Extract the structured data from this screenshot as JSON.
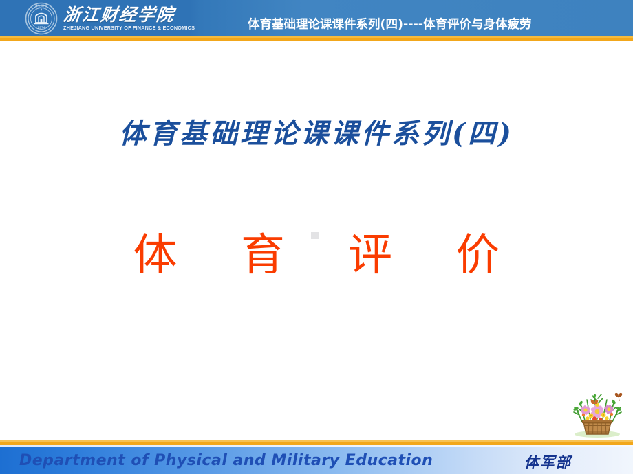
{
  "slide": {
    "header": {
      "logo": {
        "seal_icon": "university-seal-icon",
        "university_name_cn": "浙江财经学院",
        "university_name_en": "ZHEJIANG UNIVERSITY OF FINANCE & ECONOMICS"
      },
      "title": "体育基础理论课课件系列(四)----体育评价与身体疲劳",
      "band_color": "#2f73b6",
      "accent_color": "#f2a71b"
    },
    "body": {
      "series_title": "体育基础理论课课件系列(四)",
      "subject_title": "体 育 评 价",
      "series_title_color": "#1b4f9c",
      "subject_title_color": "#fa3c00",
      "decoration_icon": "flower-basket-icon"
    },
    "footer": {
      "department_en": "Department  of  Physical and  Military  Education",
      "department_cn": "体军部",
      "text_color": "#1f4fb5",
      "accent_color": "#f2a71b"
    }
  }
}
